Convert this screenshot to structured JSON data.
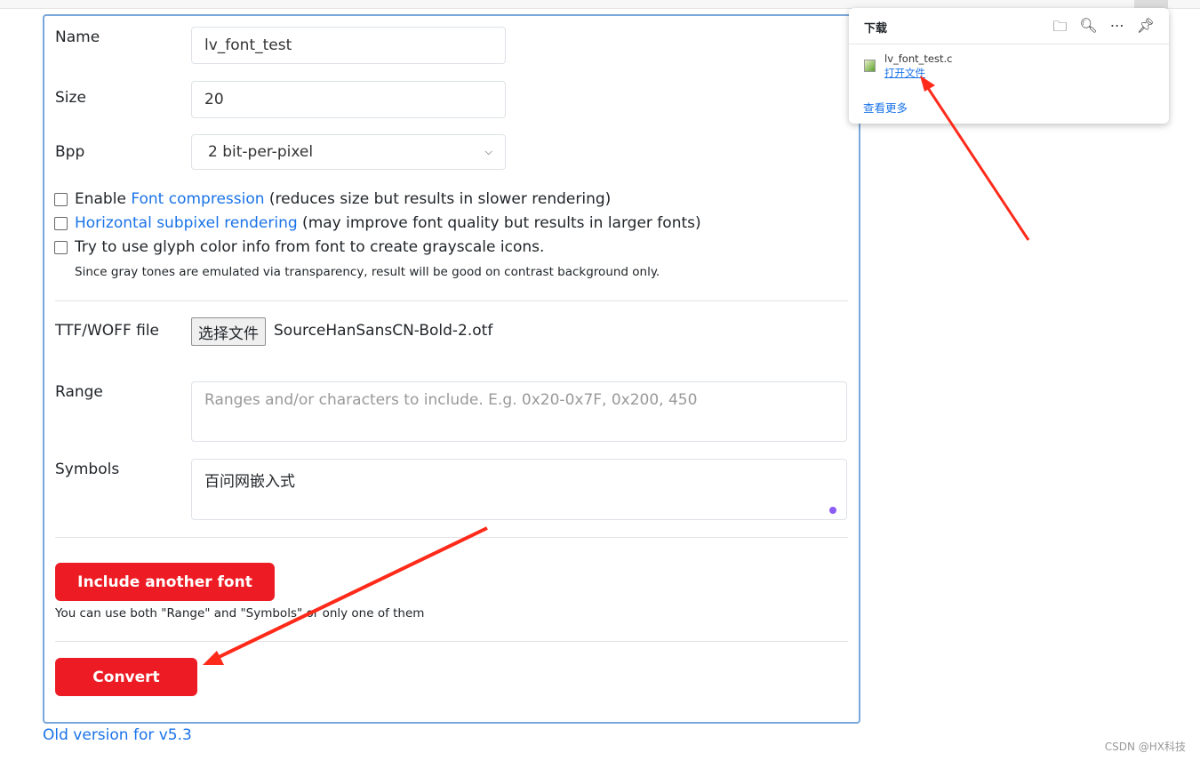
{
  "form": {
    "name_label": "Name",
    "name_value": "lv_font_test",
    "size_label": "Size",
    "size_value": "20",
    "bpp_label": "Bpp",
    "bpp_value": "2 bit-per-pixel",
    "opt1_pre": "Enable ",
    "opt1_link": "Font compression",
    "opt1_post": " (reduces size but results in slower rendering)",
    "opt2_link": "Horizontal subpixel rendering",
    "opt2_post": " (may improve font quality but results in larger fonts)",
    "opt3": "Try to use glyph color info from font to create grayscale icons.",
    "opt3_note": "Since gray tones are emulated via transparency, result will be good on contrast background only.",
    "file_label": "TTF/WOFF file",
    "file_button": "选择文件",
    "file_name": "SourceHanSansCN-Bold-2.otf",
    "range_label": "Range",
    "range_placeholder": "Ranges and/or characters to include. E.g. 0x20-0x7F, 0x200, 450",
    "symbols_label": "Symbols",
    "symbols_value": "百问网嵌入式",
    "include_button": "Include another font",
    "hint": "You can use both \"Range\" and \"Symbols\" or only one of them",
    "convert_button": "Convert"
  },
  "old_version_link": "Old version for v5.3",
  "downloads": {
    "title": "下载",
    "icons": [
      "folder-icon",
      "search-icon",
      "more-icon",
      "pin-icon"
    ],
    "file_name": "lv_font_test.c",
    "open_file": "打开文件",
    "see_more": "查看更多"
  },
  "watermark": "CSDN @HX科技",
  "colors": {
    "accent": "#ed1c24",
    "link": "#1a73e8",
    "card_border": "#7aa7db"
  }
}
